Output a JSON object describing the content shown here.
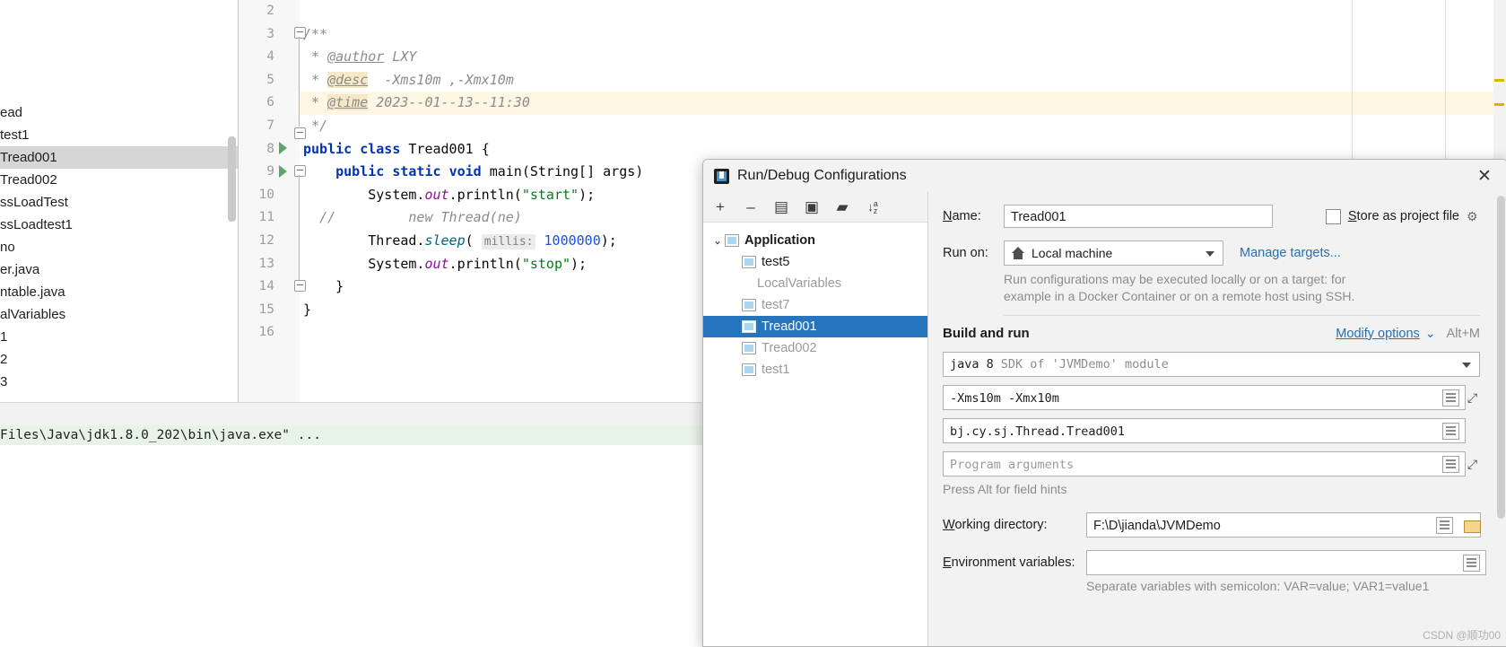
{
  "project_tree": {
    "items": [
      {
        "label": "ead",
        "selected": false
      },
      {
        "label": "test1",
        "selected": false
      },
      {
        "label": "Tread001",
        "selected": true
      },
      {
        "label": "Tread002",
        "selected": false
      },
      {
        "label": "ssLoadTest",
        "selected": false
      },
      {
        "label": "ssLoadtest1",
        "selected": false
      },
      {
        "label": "no",
        "selected": false
      },
      {
        "label": "er.java",
        "selected": false
      },
      {
        "label": "ntable.java",
        "selected": false
      },
      {
        "label": "alVariables",
        "selected": false
      },
      {
        "label": "1",
        "selected": false
      },
      {
        "label": "2",
        "selected": false
      },
      {
        "label": "3",
        "selected": false
      }
    ]
  },
  "editor": {
    "line_numbers": [
      "2",
      "3",
      "4",
      "5",
      "6",
      "7",
      "8",
      "9",
      "10",
      "11",
      "12",
      "13",
      "14",
      "15",
      "16"
    ],
    "lines": [
      {
        "n": "2",
        "text": ""
      },
      {
        "n": "3",
        "text": "/**"
      },
      {
        "n": "4",
        "text": " * @author LXY"
      },
      {
        "n": "5",
        "text": " * @desc  -Xms10m ,-Xmx10m"
      },
      {
        "n": "6",
        "text": " * @time 2023--01--13--11:30"
      },
      {
        "n": "7",
        "text": " */"
      },
      {
        "n": "8",
        "text": "public class Tread001 {"
      },
      {
        "n": "9",
        "text": "    public static void main(String[] args)"
      },
      {
        "n": "10",
        "text": "        System.out.println(\"start\");"
      },
      {
        "n": "11",
        "text": "//        new Thread(ne)"
      },
      {
        "n": "12",
        "text": "        Thread.sleep( millis: 1000000);"
      },
      {
        "n": "13",
        "text": "        System.out.println(\"stop\");"
      },
      {
        "n": "14",
        "text": "    }"
      },
      {
        "n": "15",
        "text": "}"
      },
      {
        "n": "16",
        "text": ""
      }
    ],
    "tokens": {
      "author_tag": "@author",
      "author_value": "LXY",
      "desc_tag": "@desc",
      "desc_value": "-Xms10m ,-Xmx10m",
      "time_tag": "@time",
      "time_value": "2023--01--13--11:30",
      "comment_open": "/**",
      "comment_star": "*",
      "comment_close": "*/",
      "kw_public": "public",
      "kw_class": "class",
      "kw_static": "static",
      "kw_void": "void",
      "class_name": "Tread001",
      "brace_open": "{",
      "main_sig": "main(String[] args)",
      "sysout": "System.",
      "out_field": "out",
      "println_start": ".println(",
      "str_start": "\"start\"",
      "str_stop": "\"stop\"",
      "paren_semi": ");",
      "line_comment": "//",
      "commented_code": "new Thread(ne)",
      "thread_prefix": "Thread.",
      "sleep_name": "sleep",
      "sleep_open": "(",
      "millis_hint": "millis:",
      "millis_value": "1000000",
      "close_brace_inner": "}",
      "close_brace_outer": "}"
    }
  },
  "console": {
    "line": "Files\\Java\\jdk1.8.0_202\\bin\\java.exe\" ..."
  },
  "dialog": {
    "title": "Run/Debug Configurations",
    "close_label": "✕",
    "toolbar": [
      {
        "name": "add",
        "glyph": "+"
      },
      {
        "name": "remove",
        "glyph": "–"
      },
      {
        "name": "copy",
        "glyph": "▤"
      },
      {
        "name": "save",
        "glyph": "▣"
      },
      {
        "name": "folder",
        "glyph": "▰"
      },
      {
        "name": "sort",
        "glyph": "↓"
      }
    ],
    "sort_sub": "az",
    "config_tree": [
      {
        "label": "Application",
        "type": "group",
        "selected": false,
        "dim": false
      },
      {
        "label": "test5",
        "type": "item",
        "selected": false,
        "dim": false
      },
      {
        "label": "LocalVariables",
        "type": "text",
        "selected": false,
        "dim": true
      },
      {
        "label": "test7",
        "type": "item",
        "selected": false,
        "dim": true
      },
      {
        "label": "Tread001",
        "type": "item",
        "selected": true,
        "dim": false
      },
      {
        "label": "Tread002",
        "type": "item",
        "selected": false,
        "dim": true
      },
      {
        "label": "test1",
        "type": "item",
        "selected": false,
        "dim": true
      }
    ],
    "name_label": "Name:",
    "name_label_accel": "N",
    "name_value": "Tread001",
    "store_as_project_file": "Store as project file",
    "store_accel": "S",
    "gear_glyph": "⚙",
    "run_on_label": "Run on:",
    "run_on_value": "Local machine",
    "manage_targets": "Manage targets...",
    "run_on_hint_1": "Run configurations may be executed locally or on a target: for",
    "run_on_hint_2": "example in a Docker Container or on a remote host using SSH.",
    "build_and_run": "Build and run",
    "modify_options": "Modify options",
    "modify_accel": "M",
    "modify_shortcut": "Alt+M",
    "jdk_value": "java 8",
    "jdk_desc": "SDK of 'JVMDemo' module",
    "vm_options_value": "-Xms10m -Xmx10m",
    "main_class_value": "bj.cy.sj.Thread.Tread001",
    "program_arguments_placeholder": "Program arguments",
    "field_hints": "Press Alt for field hints",
    "working_directory_label": "Working directory:",
    "working_directory_accel": "W",
    "working_directory_value": "F:\\D\\jianda\\JVMDemo",
    "environment_variables_label": "Environment variables:",
    "environment_variables_accel": "E",
    "environment_variables_value": "",
    "env_hint": "Separate variables with semicolon: VAR=value; VAR1=value1"
  },
  "watermark": "CSDN @顺功00",
  "colors": {
    "accent": "#2675bf",
    "link": "#2470b3",
    "highlight_line": "#fdf6e3",
    "console_bg": "#e8f3e8",
    "tree_selected": "#d6d6d6"
  }
}
